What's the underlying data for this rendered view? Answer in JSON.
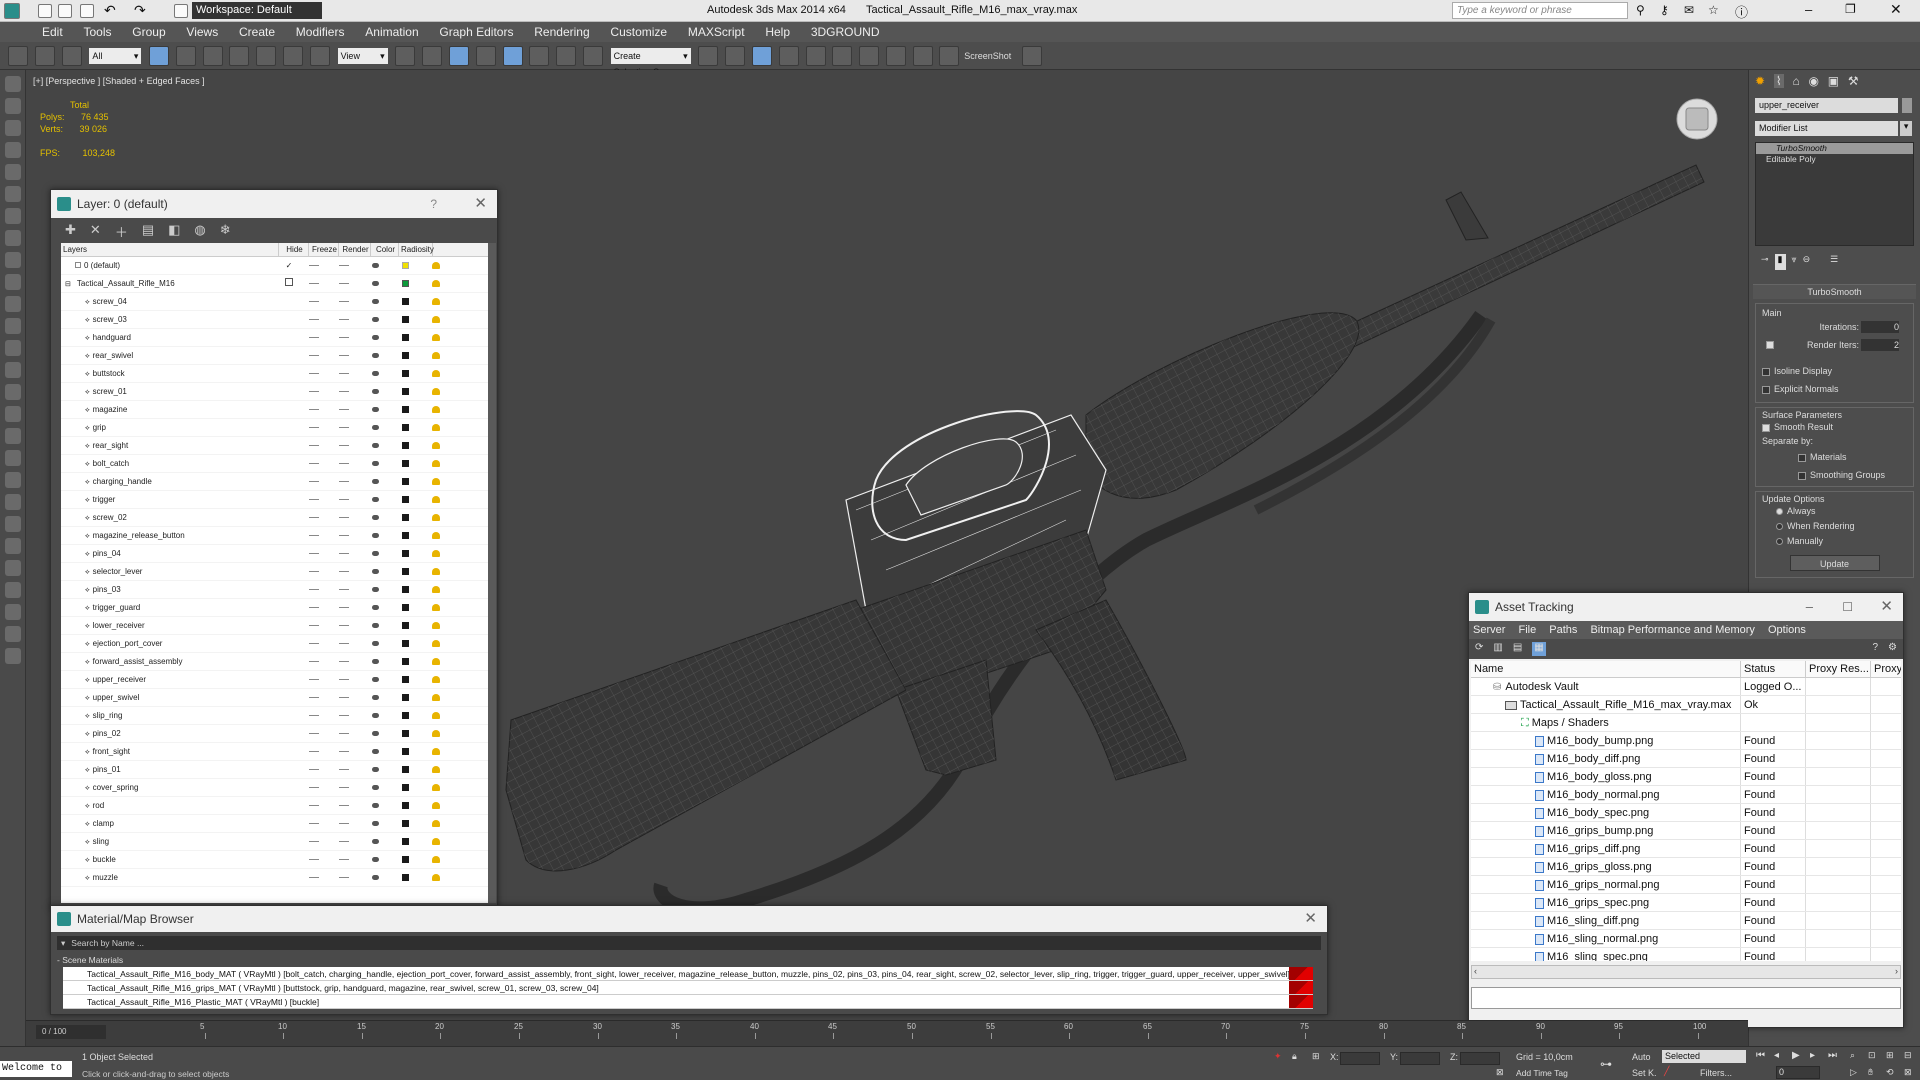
{
  "title": {
    "workspace": "Workspace: Default",
    "app": "Autodesk 3ds Max  2014 x64",
    "file": "Tactical_Assault_Rifle_M16_max_vray.max",
    "search_placeholder": "Type a keyword or phrase"
  },
  "menu": [
    "Edit",
    "Tools",
    "Group",
    "Views",
    "Create",
    "Modifiers",
    "Animation",
    "Graph Editors",
    "Rendering",
    "Customize",
    "MAXScript",
    "Help",
    "3DGROUND"
  ],
  "toolbar": {
    "filter_select": "All",
    "ref_coord": "View",
    "selection_set": "Create Selection S",
    "screenshot": "ScreenShot"
  },
  "viewport": {
    "label": "[+] [Perspective ] [Shaded + Edged Faces ]",
    "stats": {
      "total_label": "Total",
      "polys_label": "Polys:",
      "polys": "76 435",
      "verts_label": "Verts:",
      "verts": "39 026",
      "fps_label": "FPS:",
      "fps": "103,248"
    }
  },
  "layer_manager": {
    "title": "Layer: 0 (default)",
    "help": "?",
    "columns": {
      "layers": "Layers",
      "hide": "Hide",
      "freeze": "Freeze",
      "render": "Render",
      "color": "Color",
      "radiosity": "Radiosity"
    },
    "default_layer": "0 (default)",
    "group_layer": "Tactical_Assault_Rifle_M16",
    "items": [
      "screw_04",
      "screw_03",
      "handguard",
      "rear_swivel",
      "buttstock",
      "screw_01",
      "magazine",
      "grip",
      "rear_sight",
      "bolt_catch",
      "charging_handle",
      "trigger",
      "screw_02",
      "magazine_release_button",
      "pins_04",
      "selector_lever",
      "pins_03",
      "trigger_guard",
      "lower_receiver",
      "ejection_port_cover",
      "forward_assist_assembly",
      "upper_receiver",
      "upper_swivel",
      "slip_ring",
      "pins_02",
      "front_sight",
      "pins_01",
      "cover_spring",
      "rod",
      "clamp",
      "sling",
      "buckle",
      "muzzle"
    ]
  },
  "material_browser": {
    "title": "Material/Map Browser",
    "search_placeholder": "Search by Name ...",
    "section": "- Scene Materials",
    "rows": [
      "Tactical_Assault_Rifle_M16_body_MAT ( VRayMtl ) [bolt_catch, charging_handle, ejection_port_cover, forward_assist_assembly, front_sight, lower_receiver, magazine_release_button, muzzle, pins_02, pins_03, pins_04, rear_sight, screw_02, selector_lever, slip_ring, trigger, trigger_guard, upper_receiver, upper_swivel]",
      "Tactical_Assault_Rifle_M16_grips_MAT ( VRayMtl ) [buttstock, grip, handguard, magazine, rear_swivel, screw_01, screw_03, screw_04]",
      "Tactical_Assault_Rifle_M16_Plastic_MAT ( VRayMtl ) [buckle]"
    ]
  },
  "asset_tracking": {
    "title": "Asset Tracking",
    "menu": [
      "Server",
      "File",
      "Paths",
      "Bitmap Performance and Memory",
      "Options"
    ],
    "columns": {
      "name": "Name",
      "status": "Status",
      "proxy_res": "Proxy Res...",
      "proxy": "Proxy"
    },
    "vault": {
      "name": "Autodesk Vault",
      "status": "Logged O..."
    },
    "file": {
      "name": "Tactical_Assault_Rifle_M16_max_vray.max",
      "status": "Ok"
    },
    "maps_group": "Maps / Shaders",
    "files": [
      {
        "name": "M16_body_bump.png",
        "status": "Found"
      },
      {
        "name": "M16_body_diff.png",
        "status": "Found"
      },
      {
        "name": "M16_body_gloss.png",
        "status": "Found"
      },
      {
        "name": "M16_body_normal.png",
        "status": "Found"
      },
      {
        "name": "M16_body_spec.png",
        "status": "Found"
      },
      {
        "name": "M16_grips_bump.png",
        "status": "Found"
      },
      {
        "name": "M16_grips_diff.png",
        "status": "Found"
      },
      {
        "name": "M16_grips_gloss.png",
        "status": "Found"
      },
      {
        "name": "M16_grips_normal.png",
        "status": "Found"
      },
      {
        "name": "M16_grips_spec.png",
        "status": "Found"
      },
      {
        "name": "M16_sling_diff.png",
        "status": "Found"
      },
      {
        "name": "M16_sling_normal.png",
        "status": "Found"
      },
      {
        "name": "M16_sling_spec.png",
        "status": "Found"
      }
    ]
  },
  "command_panel": {
    "object_name": "upper_receiver",
    "modifier_list": "Modifier List",
    "stack": [
      "TurboSmooth",
      "Editable Poly"
    ],
    "turbosmooth": {
      "title": "TurboSmooth",
      "main": "Main",
      "iterations_label": "Iterations:",
      "iterations": "0",
      "render_iters_label": "Render Iters:",
      "render_iters": "2",
      "isoline": "Isoline Display",
      "explicit_normals": "Explicit Normals",
      "surface_params": "Surface Parameters",
      "smooth_result": "Smooth Result",
      "separate_by": "Separate by:",
      "materials": "Materials",
      "smoothing_groups": "Smoothing Groups",
      "update_options": "Update Options",
      "always": "Always",
      "when_rendering": "When Rendering",
      "manually": "Manually",
      "update": "Update"
    }
  },
  "timeline": {
    "frame": "0 / 100",
    "ticks": [
      "5",
      "10",
      "15",
      "20",
      "25",
      "30",
      "35",
      "40",
      "45",
      "50",
      "55",
      "60",
      "65",
      "70",
      "75",
      "80",
      "85",
      "90",
      "95",
      "100"
    ]
  },
  "status": {
    "welcome": "Welcome to",
    "selected": "1 Object Selected",
    "prompt": "Click or click-and-drag to select objects",
    "x_label": "X:",
    "y_label": "Y:",
    "z_label": "Z:",
    "grid": "Grid = 10,0cm",
    "add_time_tag": "Add Time Tag",
    "auto": "Auto",
    "selected_dropdown": "Selected",
    "setk": "Set K.",
    "filters": "Filters...",
    "frame_field": "0"
  },
  "colors": {
    "accent": "#6fa0d8",
    "yellow_stats": "#e4c000",
    "found_red": "#e10000"
  }
}
